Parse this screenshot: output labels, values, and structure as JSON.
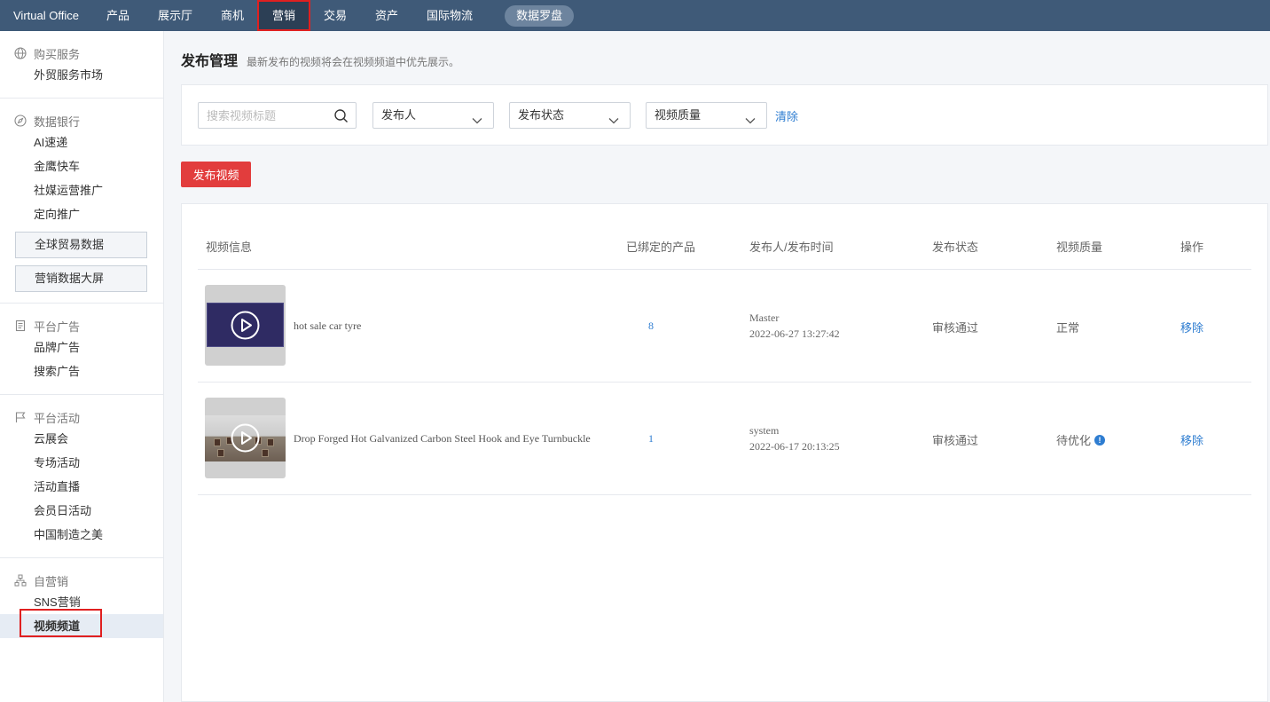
{
  "topnav": {
    "brand": "Virtual Office",
    "items": [
      "产品",
      "展示厅",
      "商机",
      "营销",
      "交易",
      "资产",
      "国际物流"
    ],
    "active_index": 3,
    "pill": "数据罗盘"
  },
  "sidebar": {
    "groups": [
      {
        "title": "购买服务",
        "icon": "globe-icon",
        "items": [
          "外贸服务市场"
        ]
      },
      {
        "title": "数据银行",
        "icon": "compass-icon",
        "items": [
          "AI速递",
          "金鹰快车",
          "社媒运营推广",
          "定向推广"
        ],
        "boxes": [
          "全球贸易数据",
          "营销数据大屏"
        ]
      },
      {
        "title": "平台广告",
        "icon": "document-icon",
        "items": [
          "品牌广告",
          "搜索广告"
        ]
      },
      {
        "title": "平台活动",
        "icon": "flag-icon",
        "items": [
          "云展会",
          "专场活动",
          "活动直播",
          "会员日活动",
          "中国制造之美"
        ]
      },
      {
        "title": "自营销",
        "icon": "sitemap-icon",
        "items": [
          "SNS营销",
          "视频频道"
        ],
        "active_item": "视频频道"
      }
    ]
  },
  "main": {
    "title": "发布管理",
    "subtitle": "最新发布的视频将会在视频频道中优先展示。",
    "filters": {
      "search_placeholder": "搜索视频标题",
      "publisher_label": "发布人",
      "status_label": "发布状态",
      "quality_label": "视频质量",
      "clear_label": "清除"
    },
    "publish_button": "发布视频",
    "table": {
      "headers": [
        "视频信息",
        "已绑定的产品",
        "发布人/发布时间",
        "发布状态",
        "视频质量",
        "操作"
      ],
      "rows": [
        {
          "title": "hot sale car tyre",
          "bound": "8",
          "publisher": "Master",
          "time": "2022-06-27 13:27:42",
          "status": "审核通过",
          "quality": "正常",
          "action": "移除"
        },
        {
          "title": "Drop Forged Hot Galvanized Carbon Steel Hook and Eye Turnbuckle",
          "bound": "1",
          "publisher": "system",
          "time": "2022-06-17 20:13:25",
          "status": "审核通过",
          "quality": "待优化",
          "quality_info": "!",
          "action": "移除"
        }
      ]
    }
  },
  "colors": {
    "nav_bg": "#3f5a78",
    "accent_red": "#e23d3d",
    "link_blue": "#2e7dd1"
  }
}
